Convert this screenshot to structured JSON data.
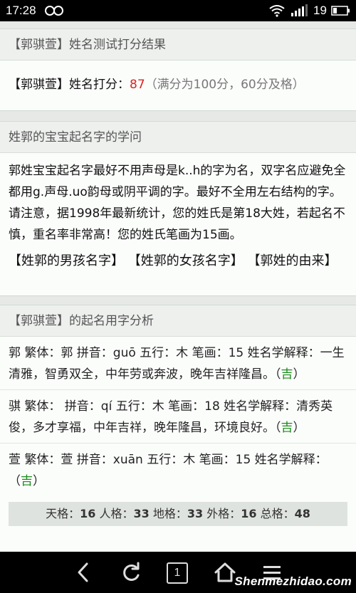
{
  "status": {
    "time": "17:28",
    "battery": "19"
  },
  "card1": {
    "title": "【郭骐萱】姓名测试打分结果",
    "score_label": "【郭骐萱】姓名打分：",
    "score": "87",
    "note": "（满分为100分，60分及格）"
  },
  "card2": {
    "title": "姓郭的宝宝起名字的学问",
    "text": "郭姓宝宝起名字最好不用声母是k..h的字为名，双字名应避免全都用g.声母.uo韵母或阴平调的字。最好不全用左右结构的字。请注意，据1998年最新统计，您的姓氏是第18大姓，若起名不慎，重名率非常高！您的姓氏笔画为15画。",
    "links": [
      "【姓郭的男孩名字】",
      "【姓郭的女孩名字】",
      "【郭姓的由来】"
    ]
  },
  "card3": {
    "title": "【郭骐萱】的起名用字分析",
    "chars": [
      {
        "text": "郭 繁体：郭 拼音：guō 五行：木 笔画：15 姓名学解释：一生清雅，智勇双全，中年劳或奔波，晚年吉祥隆昌。",
        "open": "（",
        "verdict": "吉",
        "close": "）"
      },
      {
        "text": "骐 繁体： 拼音：qí 五行：木 笔画：18 姓名学解释：清秀英俊，多才享福，中年吉祥，晚年隆昌，环境良好。",
        "open": "（",
        "verdict": "吉",
        "close": "）"
      },
      {
        "text": "萱 繁体：萱 拼音：xuān 五行：木 笔画：15 姓名学解释：",
        "open": "（",
        "verdict": "吉",
        "close": "）"
      }
    ],
    "grid": [
      {
        "label": "天格：",
        "value": "16"
      },
      {
        "label": "人格：",
        "value": "33"
      },
      {
        "label": "地格：",
        "value": "33"
      },
      {
        "label": "外格：",
        "value": "16"
      },
      {
        "label": "总格：",
        "value": "48"
      }
    ]
  },
  "nav": {
    "icons": [
      "back-icon",
      "refresh-icon",
      "tabs-icon",
      "home-icon",
      "more-icon"
    ],
    "tab_count": "1"
  },
  "watermark": "Shenmezhidao.com"
}
